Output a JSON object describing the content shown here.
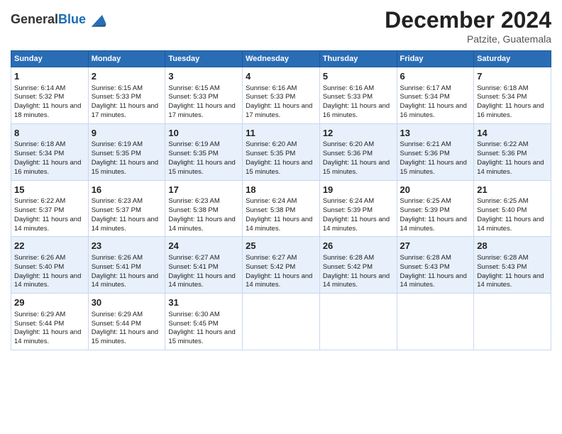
{
  "header": {
    "logo_general": "General",
    "logo_blue": "Blue",
    "month_year": "December 2024",
    "location": "Patzite, Guatemala"
  },
  "days_of_week": [
    "Sunday",
    "Monday",
    "Tuesday",
    "Wednesday",
    "Thursday",
    "Friday",
    "Saturday"
  ],
  "weeks": [
    [
      {
        "day": "1",
        "sunrise": "6:14 AM",
        "sunset": "5:32 PM",
        "daylight": "11 hours and 18 minutes"
      },
      {
        "day": "2",
        "sunrise": "6:15 AM",
        "sunset": "5:33 PM",
        "daylight": "11 hours and 17 minutes"
      },
      {
        "day": "3",
        "sunrise": "6:15 AM",
        "sunset": "5:33 PM",
        "daylight": "11 hours and 17 minutes"
      },
      {
        "day": "4",
        "sunrise": "6:16 AM",
        "sunset": "5:33 PM",
        "daylight": "11 hours and 17 minutes"
      },
      {
        "day": "5",
        "sunrise": "6:16 AM",
        "sunset": "5:33 PM",
        "daylight": "11 hours and 16 minutes"
      },
      {
        "day": "6",
        "sunrise": "6:17 AM",
        "sunset": "5:34 PM",
        "daylight": "11 hours and 16 minutes"
      },
      {
        "day": "7",
        "sunrise": "6:18 AM",
        "sunset": "5:34 PM",
        "daylight": "11 hours and 16 minutes"
      }
    ],
    [
      {
        "day": "8",
        "sunrise": "6:18 AM",
        "sunset": "5:34 PM",
        "daylight": "11 hours and 16 minutes"
      },
      {
        "day": "9",
        "sunrise": "6:19 AM",
        "sunset": "5:35 PM",
        "daylight": "11 hours and 15 minutes"
      },
      {
        "day": "10",
        "sunrise": "6:19 AM",
        "sunset": "5:35 PM",
        "daylight": "11 hours and 15 minutes"
      },
      {
        "day": "11",
        "sunrise": "6:20 AM",
        "sunset": "5:35 PM",
        "daylight": "11 hours and 15 minutes"
      },
      {
        "day": "12",
        "sunrise": "6:20 AM",
        "sunset": "5:36 PM",
        "daylight": "11 hours and 15 minutes"
      },
      {
        "day": "13",
        "sunrise": "6:21 AM",
        "sunset": "5:36 PM",
        "daylight": "11 hours and 15 minutes"
      },
      {
        "day": "14",
        "sunrise": "6:22 AM",
        "sunset": "5:36 PM",
        "daylight": "11 hours and 14 minutes"
      }
    ],
    [
      {
        "day": "15",
        "sunrise": "6:22 AM",
        "sunset": "5:37 PM",
        "daylight": "11 hours and 14 minutes"
      },
      {
        "day": "16",
        "sunrise": "6:23 AM",
        "sunset": "5:37 PM",
        "daylight": "11 hours and 14 minutes"
      },
      {
        "day": "17",
        "sunrise": "6:23 AM",
        "sunset": "5:38 PM",
        "daylight": "11 hours and 14 minutes"
      },
      {
        "day": "18",
        "sunrise": "6:24 AM",
        "sunset": "5:38 PM",
        "daylight": "11 hours and 14 minutes"
      },
      {
        "day": "19",
        "sunrise": "6:24 AM",
        "sunset": "5:39 PM",
        "daylight": "11 hours and 14 minutes"
      },
      {
        "day": "20",
        "sunrise": "6:25 AM",
        "sunset": "5:39 PM",
        "daylight": "11 hours and 14 minutes"
      },
      {
        "day": "21",
        "sunrise": "6:25 AM",
        "sunset": "5:40 PM",
        "daylight": "11 hours and 14 minutes"
      }
    ],
    [
      {
        "day": "22",
        "sunrise": "6:26 AM",
        "sunset": "5:40 PM",
        "daylight": "11 hours and 14 minutes"
      },
      {
        "day": "23",
        "sunrise": "6:26 AM",
        "sunset": "5:41 PM",
        "daylight": "11 hours and 14 minutes"
      },
      {
        "day": "24",
        "sunrise": "6:27 AM",
        "sunset": "5:41 PM",
        "daylight": "11 hours and 14 minutes"
      },
      {
        "day": "25",
        "sunrise": "6:27 AM",
        "sunset": "5:42 PM",
        "daylight": "11 hours and 14 minutes"
      },
      {
        "day": "26",
        "sunrise": "6:28 AM",
        "sunset": "5:42 PM",
        "daylight": "11 hours and 14 minutes"
      },
      {
        "day": "27",
        "sunrise": "6:28 AM",
        "sunset": "5:43 PM",
        "daylight": "11 hours and 14 minutes"
      },
      {
        "day": "28",
        "sunrise": "6:28 AM",
        "sunset": "5:43 PM",
        "daylight": "11 hours and 14 minutes"
      }
    ],
    [
      {
        "day": "29",
        "sunrise": "6:29 AM",
        "sunset": "5:44 PM",
        "daylight": "11 hours and 14 minutes"
      },
      {
        "day": "30",
        "sunrise": "6:29 AM",
        "sunset": "5:44 PM",
        "daylight": "11 hours and 15 minutes"
      },
      {
        "day": "31",
        "sunrise": "6:30 AM",
        "sunset": "5:45 PM",
        "daylight": "11 hours and 15 minutes"
      },
      null,
      null,
      null,
      null
    ]
  ],
  "labels": {
    "sunrise": "Sunrise:",
    "sunset": "Sunset:",
    "daylight": "Daylight:"
  }
}
